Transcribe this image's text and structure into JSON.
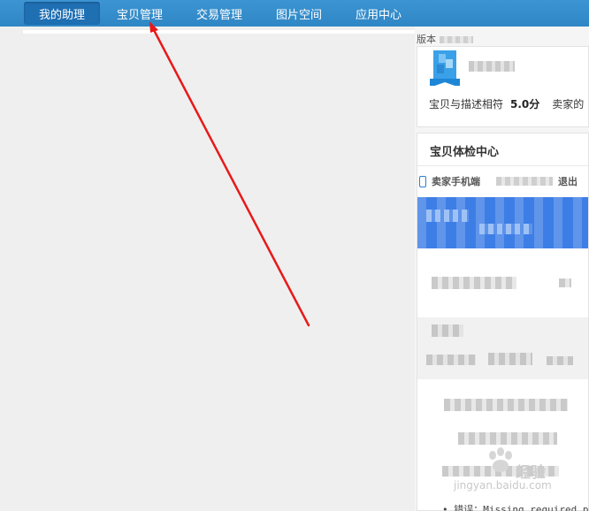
{
  "nav": {
    "tabs": [
      {
        "label": "我的助理"
      },
      {
        "label": "宝贝管理"
      },
      {
        "label": "交易管理"
      },
      {
        "label": "图片空间"
      },
      {
        "label": "应用中心"
      }
    ]
  },
  "version": {
    "label": "版本"
  },
  "shop": {
    "rating_label": "宝贝与描述相符",
    "rating_value": "5.0分",
    "rating_next": "卖家的"
  },
  "check_center": {
    "title": "宝贝体检中心",
    "mobile_label": "卖家手机端",
    "logout_label": "退出"
  },
  "watermark": {
    "text": "经验",
    "url": "jingyan.baidu.com"
  },
  "error_line": "• 错误：Missing required pa",
  "colors": {
    "nav_bg": "#3a92d0",
    "nav_active": "#1f6fb3",
    "blue_block": "#3d7ee6",
    "arrow": "#e8191a"
  }
}
